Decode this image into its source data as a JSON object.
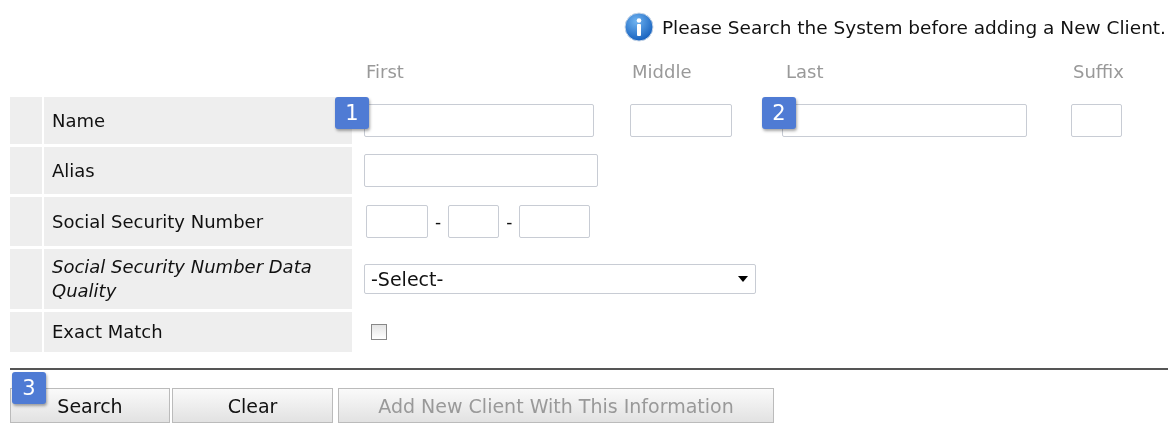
{
  "notice": {
    "text": "Please Search the System before adding a New Client."
  },
  "name_fields": [
    {
      "label": "First",
      "callout": "1"
    },
    {
      "label": "Middle"
    },
    {
      "label": "Last",
      "callout": "2"
    },
    {
      "label": "Suffix"
    }
  ],
  "rows": [
    {
      "kind": "name",
      "label": "Name",
      "italic": false
    },
    {
      "kind": "text",
      "label": "Alias",
      "italic": false
    },
    {
      "kind": "ssn",
      "label": "Social Security Number",
      "italic": false,
      "separators": [
        "-",
        "-"
      ]
    },
    {
      "kind": "select",
      "label": "Social Security Number Data Quality",
      "italic": true,
      "value": "-Select-"
    },
    {
      "kind": "checkbox",
      "label": "Exact Match",
      "italic": false,
      "checked": false
    }
  ],
  "buttons": [
    {
      "label": "Search",
      "disabled": false,
      "callout": "3"
    },
    {
      "label": "Clear",
      "disabled": false
    },
    {
      "label": "Add New Client With This Information",
      "disabled": true
    }
  ]
}
